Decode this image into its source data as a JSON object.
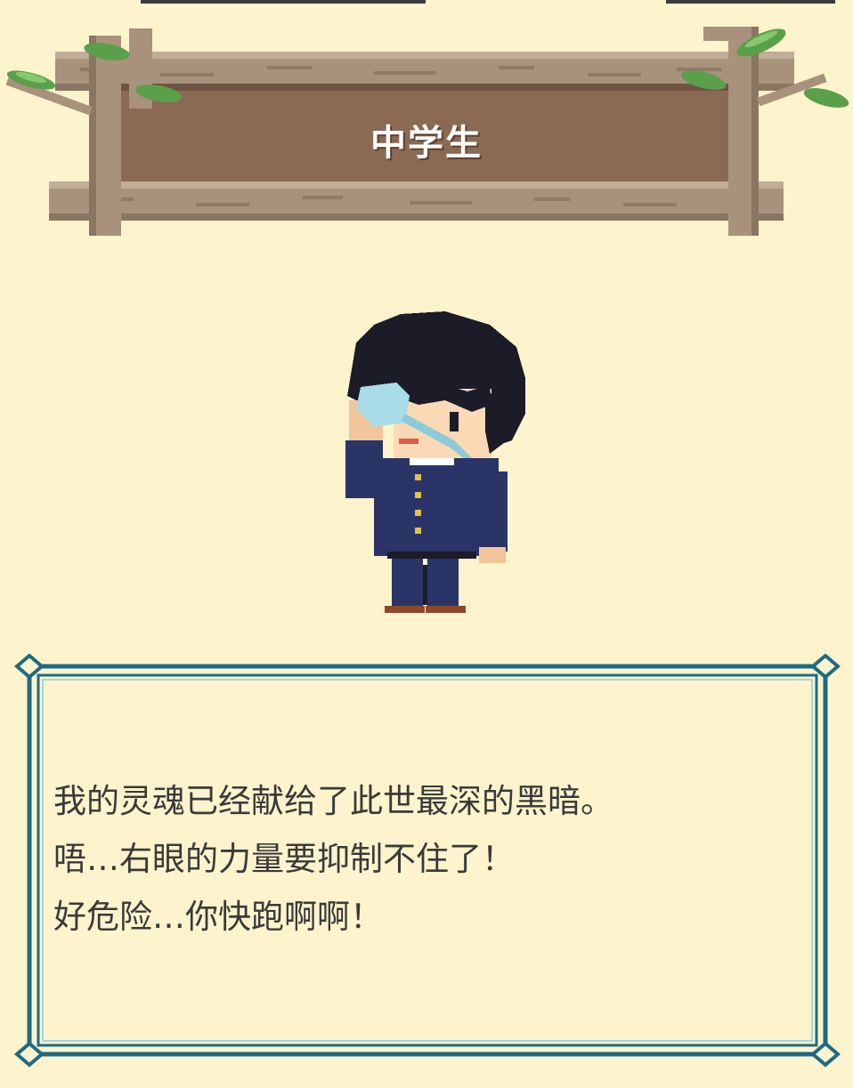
{
  "title": "中学生",
  "dialog": {
    "lines": [
      "我的灵魂已经献给了此世最深的黑暗。",
      "唔…右眼的力量要抑制不住了！",
      "好危险…你快跑啊啊！"
    ]
  },
  "colors": {
    "background": "#fdf4cd",
    "sign_wood": "#8b6a52",
    "frame_teal": "#1f6a84",
    "text": "#3a3a3a"
  }
}
